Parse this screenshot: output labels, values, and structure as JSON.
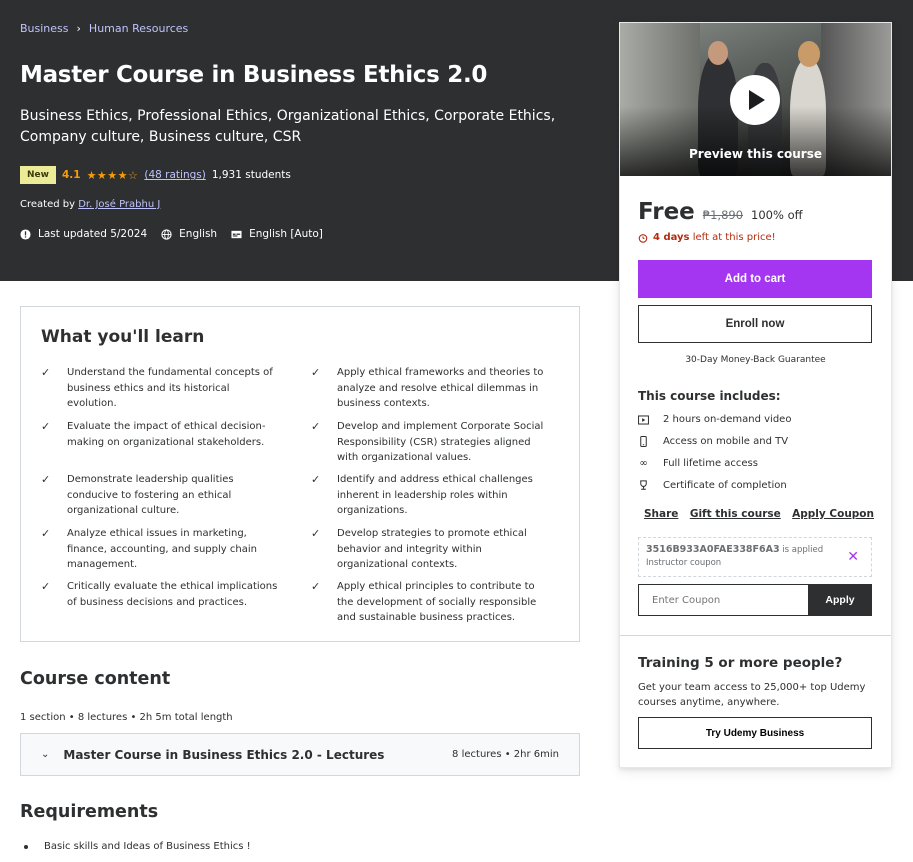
{
  "breadcrumb": {
    "items": [
      "Business",
      "Human Resources"
    ],
    "separator": "›"
  },
  "course": {
    "title": "Master Course in Business Ethics 2.0",
    "subtitle": "Business Ethics, Professional Ethics, Organizational Ethics, Corporate Ethics, Company culture, Business culture, CSR",
    "badge": "New",
    "rating": "4.1",
    "stars": "★★★★☆",
    "ratings_count": "(48 ratings)",
    "students": "1,931 students",
    "created_by_label": "Created by",
    "instructor": "Dr. José Prabhu J",
    "last_updated": "Last updated 5/2024",
    "language": "English",
    "captions": "English [Auto]"
  },
  "learn": {
    "title": "What you'll learn",
    "items": [
      "Understand the fundamental concepts of business ethics and its historical evolution.",
      "Apply ethical frameworks and theories to analyze and resolve ethical dilemmas in business contexts.",
      "Evaluate the impact of ethical decision-making on organizational stakeholders.",
      "Develop and implement Corporate Social Responsibility (CSR) strategies aligned with organizational values.",
      "Demonstrate leadership qualities conducive to fostering an ethical organizational culture.",
      "Identify and address ethical challenges inherent in leadership roles within organizations.",
      "Analyze ethical issues in marketing, finance, accounting, and supply chain management.",
      "Develop strategies to promote ethical behavior and integrity within organizational contexts.",
      "Critically evaluate the ethical implications of business decisions and practices.",
      "Apply ethical principles to contribute to the development of socially responsible and sustainable business practices."
    ]
  },
  "content": {
    "title": "Course content",
    "meta": "1 section • 8 lectures • 2h 5m total length",
    "section_title": "Master Course in Business Ethics 2.0 - Lectures",
    "section_meta": "8 lectures • 2hr 6min"
  },
  "requirements": {
    "title": "Requirements",
    "items": [
      "Basic skills and Ideas of Business Ethics !"
    ]
  },
  "sidebar": {
    "preview_label": "Preview this course",
    "price": "Free",
    "old_price": "₱1,890",
    "discount": "100% off",
    "countdown_bold": "4 days",
    "countdown_rest": "left at this price!",
    "add_to_cart": "Add to cart",
    "enroll": "Enroll now",
    "guarantee": "30-Day Money-Back Guarantee",
    "includes_title": "This course includes:",
    "includes": [
      {
        "icon": "video-icon",
        "text": "2 hours on-demand video"
      },
      {
        "icon": "mobile-icon",
        "text": "Access on mobile and TV"
      },
      {
        "icon": "infinity-icon",
        "text": "Full lifetime access"
      },
      {
        "icon": "trophy-icon",
        "text": "Certificate of completion"
      }
    ],
    "share": "Share",
    "gift": "Gift this course",
    "apply_coupon": "Apply Coupon",
    "coupon_code": "3516B933A0FAE338F6A3",
    "coupon_applied": "is applied",
    "coupon_type": "Instructor coupon",
    "coupon_placeholder": "Enter Coupon",
    "coupon_apply_btn": "Apply",
    "training_title": "Training 5 or more people?",
    "training_text": "Get your team access to 25,000+ top Udemy courses anytime, anywhere.",
    "business_btn": "Try Udemy Business"
  },
  "colors": {
    "hero_bg": "#2d2f31",
    "accent": "#a435f0",
    "link_light": "#c0c4fc",
    "star": "#f69c08",
    "alert": "#b32d0f"
  }
}
